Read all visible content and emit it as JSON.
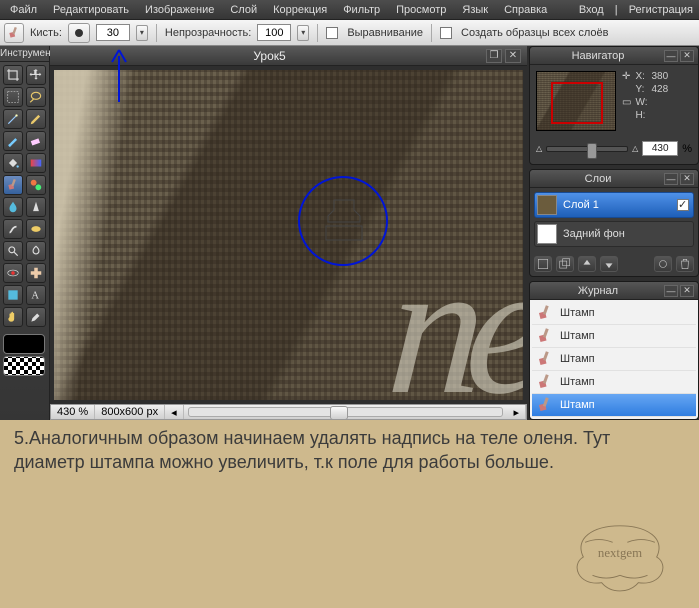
{
  "menu": {
    "file": "Файл",
    "edit": "Редактировать",
    "image": "Изображение",
    "layer": "Слой",
    "correction": "Коррекция",
    "filter": "Фильтр",
    "view": "Просмотр",
    "language": "Язык",
    "help": "Справка",
    "login": "Вход",
    "register": "Регистрация",
    "sep": "|"
  },
  "toolbar": {
    "brush_label": "Кисть:",
    "brush_size": "30",
    "opacity_label": "Непрозрачность:",
    "opacity_value": "100",
    "align_label": "Выравнивание",
    "sample_label": "Создать образцы всех слоёв"
  },
  "toolbox_title": "Инструмент",
  "doc": {
    "title": "Урок5",
    "zoom": "430 %",
    "dims": "800x600 px"
  },
  "nav": {
    "title": "Навигатор",
    "x_label": "X:",
    "x": "380",
    "y_label": "Y:",
    "y": "428",
    "w_label": "W:",
    "h_label": "H:",
    "zoom": "430",
    "pct": "%"
  },
  "layers": {
    "title": "Слои",
    "layer1": "Слой 1",
    "bg": "Задний фон"
  },
  "history": {
    "title": "Журнал",
    "items": [
      "Штамп",
      "Штамп",
      "Штамп",
      "Штамп",
      "Штамп"
    ]
  },
  "caption": "5.Аналогичным образом начинаем удалять надпись на теле оленя. Тут диаметр штампа можно увеличить, т.к  поле для работы больше.",
  "watermark": {
    "main": "nextgem"
  },
  "canvas_letters": "ne"
}
